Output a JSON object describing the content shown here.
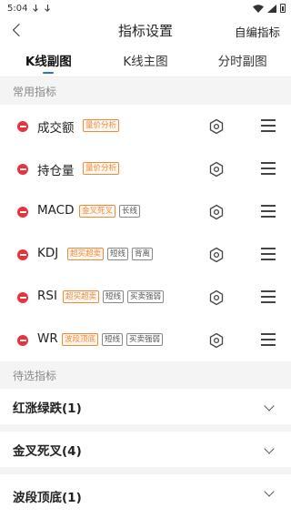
{
  "status": {
    "time": "5:04"
  },
  "nav": {
    "title": "指标设置",
    "action": "自编指标"
  },
  "tabs": [
    {
      "label": "K线副图",
      "active": true
    },
    {
      "label": "K线主图",
      "active": false
    },
    {
      "label": "分时副图",
      "active": false
    }
  ],
  "sections": {
    "common": "常用指标",
    "pending": "待选指标"
  },
  "indicators": [
    {
      "name": "成交额",
      "tags": [
        {
          "text": "量价分析",
          "style": "orange"
        }
      ]
    },
    {
      "name": "持仓量",
      "tags": [
        {
          "text": "量价分析",
          "style": "orange"
        }
      ]
    },
    {
      "name": "MACD",
      "tags": [
        {
          "text": "金叉死叉",
          "style": "orange"
        },
        {
          "text": "长线",
          "style": "gray"
        }
      ]
    },
    {
      "name": "KDJ",
      "tags": [
        {
          "text": "超买超卖",
          "style": "orange"
        },
        {
          "text": "短线",
          "style": "gray"
        },
        {
          "text": "背离",
          "style": "gray"
        }
      ]
    },
    {
      "name": "RSI",
      "tags": [
        {
          "text": "超买超卖",
          "style": "orange"
        },
        {
          "text": "短线",
          "style": "gray"
        },
        {
          "text": "买卖强弱",
          "style": "gray"
        }
      ]
    },
    {
      "name": "WR",
      "tags": [
        {
          "text": "波段顶底",
          "style": "orange"
        },
        {
          "text": "短线",
          "style": "gray"
        },
        {
          "text": "买卖强弱",
          "style": "gray"
        }
      ]
    }
  ],
  "groups": [
    {
      "label": "红涨绿跌(1)"
    },
    {
      "label": "金叉死叉(4)"
    },
    {
      "label": "波段顶底(1)"
    }
  ],
  "icons": {
    "remove": "minus-circle-icon",
    "settings": "gear-icon",
    "drag": "drag-handle-icon",
    "expand": "chevron-down-icon"
  },
  "colors": {
    "accent": "#2b6fd6",
    "remove": "#e8333a",
    "tag_orange": "#f08a3c"
  }
}
